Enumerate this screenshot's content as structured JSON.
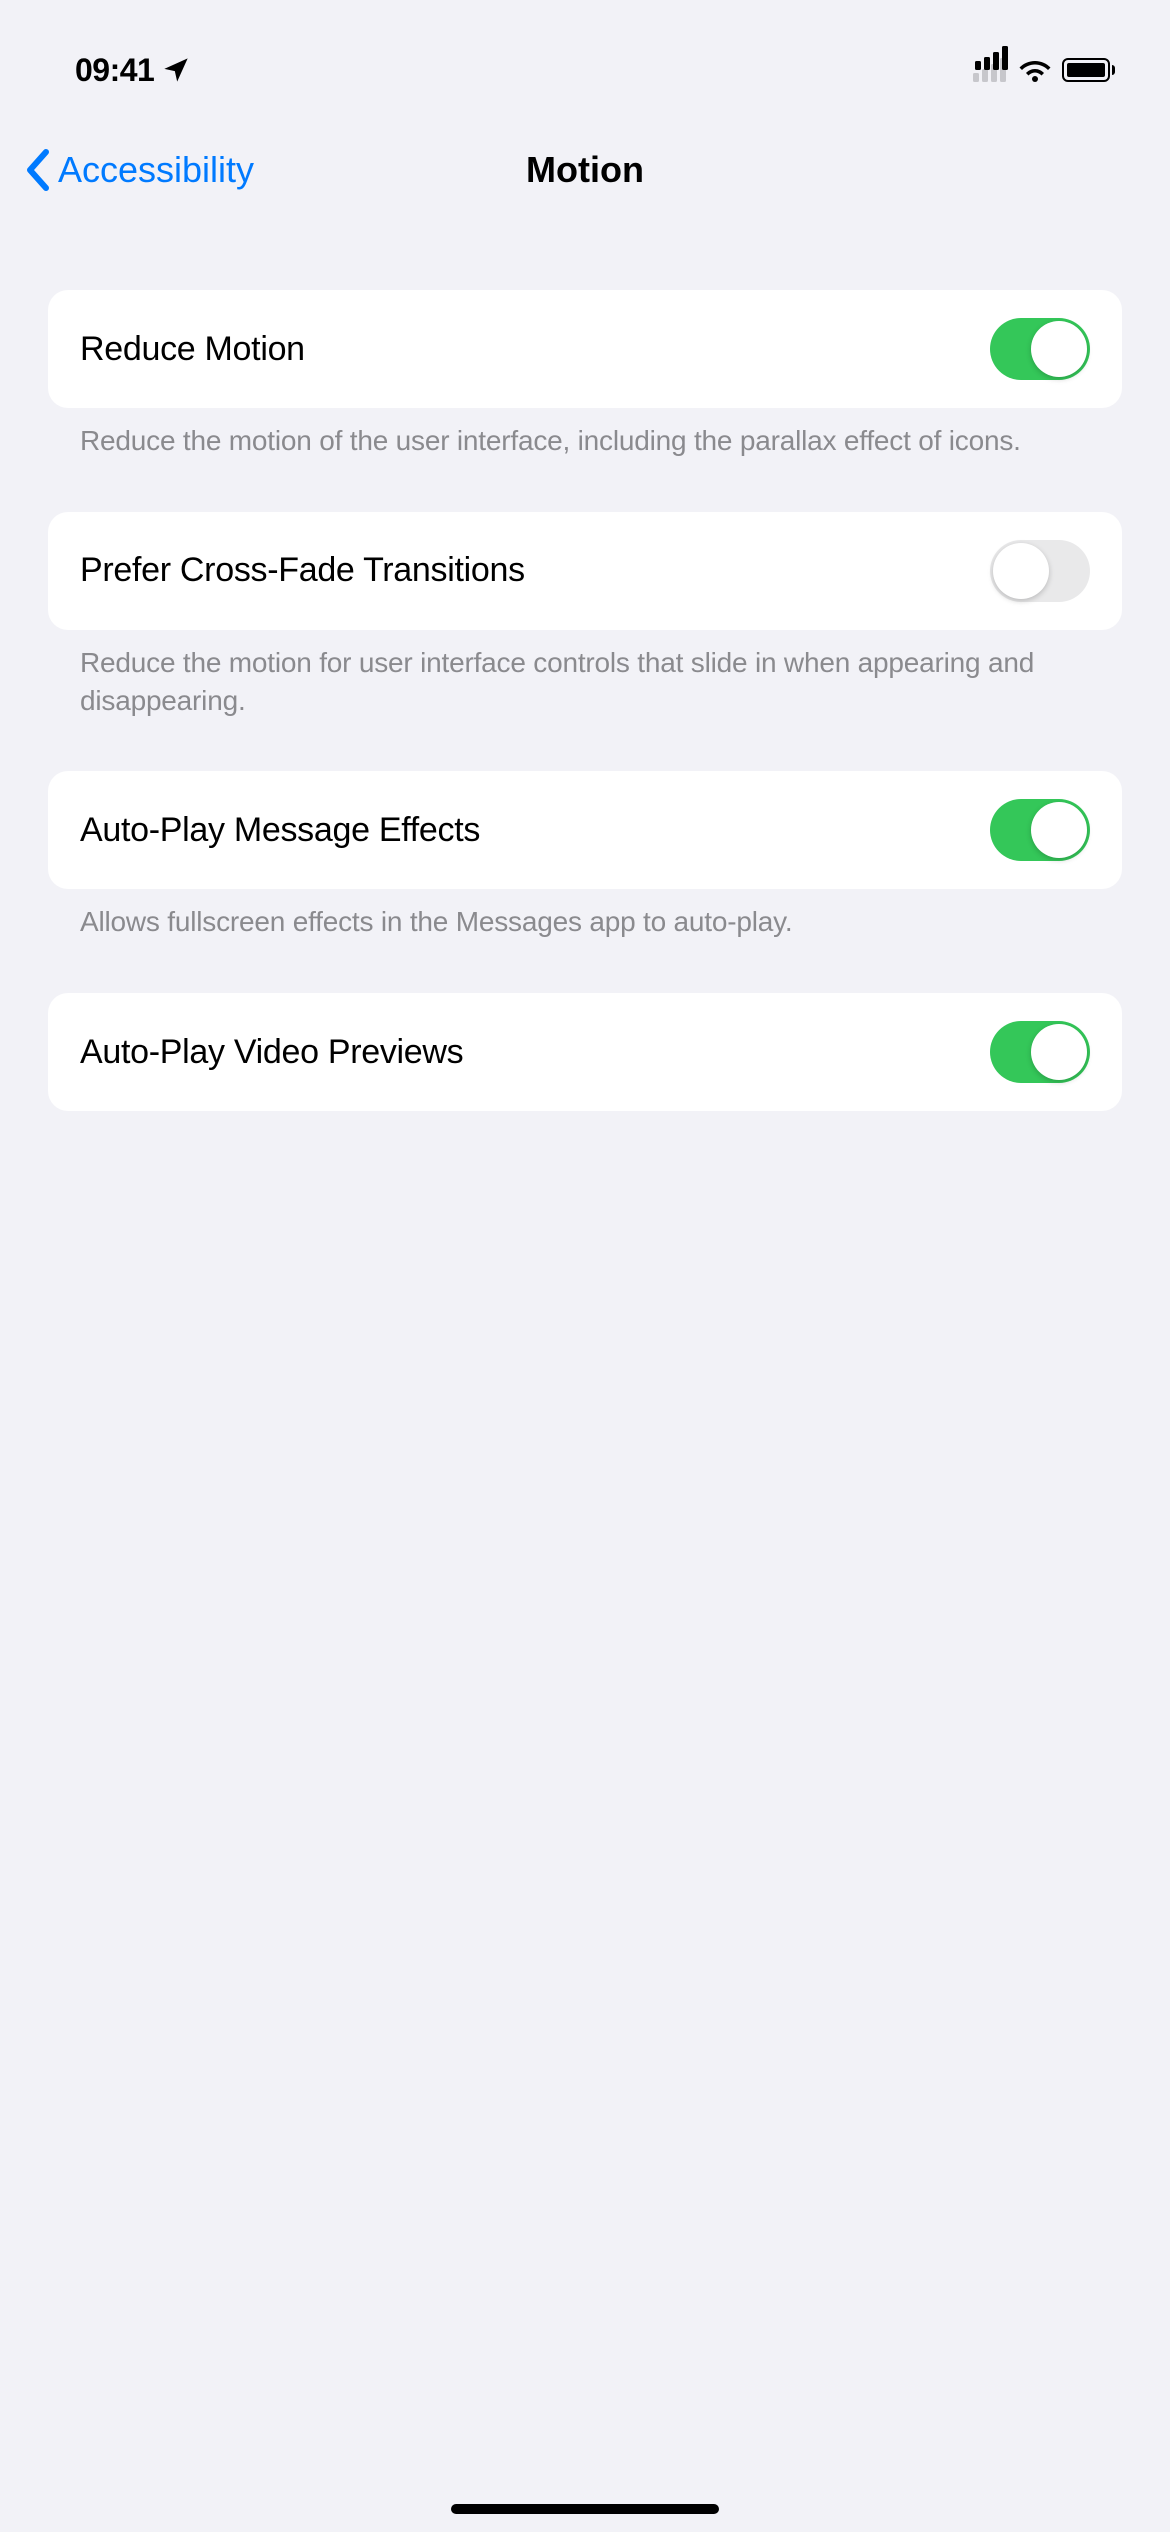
{
  "status_bar": {
    "time": "09:41"
  },
  "nav": {
    "back_label": "Accessibility",
    "title": "Motion"
  },
  "settings": {
    "reduce_motion": {
      "label": "Reduce Motion",
      "enabled": true,
      "footer": "Reduce the motion of the user interface, including the parallax effect of icons."
    },
    "cross_fade": {
      "label": "Prefer Cross-Fade Transitions",
      "enabled": false,
      "footer": "Reduce the motion for user interface controls that slide in when appearing and disappearing."
    },
    "message_effects": {
      "label": "Auto-Play Message Effects",
      "enabled": true,
      "footer": "Allows fullscreen effects in the Messages app to auto-play."
    },
    "video_previews": {
      "label": "Auto-Play Video Previews",
      "enabled": true
    }
  }
}
